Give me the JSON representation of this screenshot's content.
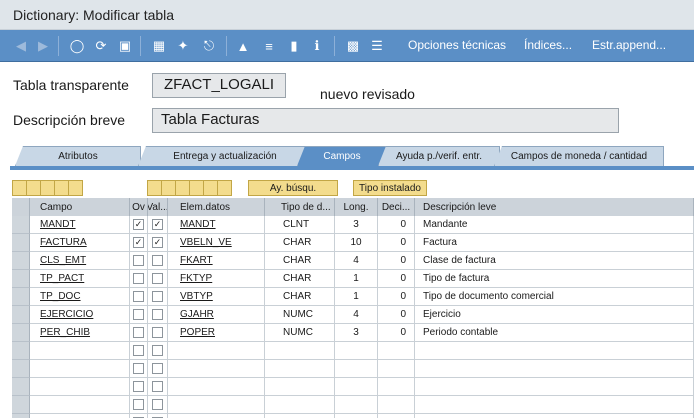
{
  "window": {
    "title": "Dictionary: Modificar tabla"
  },
  "toolbar": {
    "icons": [
      "back-arrow-icon",
      "forward-arrow-icon",
      "glasses-icon",
      "refresh-icon",
      "lock-icon",
      "object-icon",
      "wand-icon",
      "hierarchy-icon",
      "tree-icon",
      "align-icon",
      "blank-icon",
      "info-icon",
      "color-blocks-icon",
      "barcode-icon"
    ],
    "technical_options": "Opciones técnicas",
    "indexes": "Índices...",
    "append_structure": "Estr.append..."
  },
  "form": {
    "table_label": "Tabla transparente",
    "table_value": "ZFACT_LOGALI",
    "status": "nuevo revisado",
    "desc_label": "Descripción breve",
    "desc_value": "Tabla Facturas"
  },
  "tabs": [
    {
      "label": "Atributos",
      "active": false
    },
    {
      "label": "Entrega y actualización",
      "active": false
    },
    {
      "label": "Campos",
      "active": true
    },
    {
      "label": "Ayuda p./verif. entr.",
      "active": false
    },
    {
      "label": "Campos de moneda / cantidad",
      "active": false
    }
  ],
  "buttons": {
    "search_help": "Ay. búsqu.",
    "built_in_type": "Tipo instalado"
  },
  "table": {
    "headers": {
      "campo": "Campo",
      "ov": "Ov",
      "val": "Val...",
      "elem": "Elem.datos",
      "tipo": "Tipo de d...",
      "long": "Long.",
      "deci": "Deci...",
      "desc": "Descripción leve"
    },
    "rows": [
      {
        "campo": "MANDT",
        "ov": true,
        "val": true,
        "elem": "MANDT",
        "tipo": "CLNT",
        "long": "3",
        "deci": "0",
        "desc": "Mandante"
      },
      {
        "campo": "FACTURA",
        "ov": true,
        "val": true,
        "elem": "VBELN_VE",
        "tipo": "CHAR",
        "long": "10",
        "deci": "0",
        "desc": "Factura"
      },
      {
        "campo": "CLS_EMT",
        "ov": false,
        "val": false,
        "elem": "FKART",
        "tipo": "CHAR",
        "long": "4",
        "deci": "0",
        "desc": "Clase de factura"
      },
      {
        "campo": "TP_PACT",
        "ov": false,
        "val": false,
        "elem": "FKTYP",
        "tipo": "CHAR",
        "long": "1",
        "deci": "0",
        "desc": "Tipo de factura"
      },
      {
        "campo": "TP_DOC",
        "ov": false,
        "val": false,
        "elem": "VBTYP",
        "tipo": "CHAR",
        "long": "1",
        "deci": "0",
        "desc": "Tipo de documento comercial"
      },
      {
        "campo": "EJERCICIO",
        "ov": false,
        "val": false,
        "elem": "GJAHR",
        "tipo": "NUMC",
        "long": "4",
        "deci": "0",
        "desc": "Ejercicio"
      },
      {
        "campo": "PER_CHIB",
        "ov": false,
        "val": false,
        "elem": "POPER",
        "tipo": "NUMC",
        "long": "3",
        "deci": "0",
        "desc": "Periodo contable"
      }
    ],
    "empty_rows": 5
  },
  "colors": {
    "toolbar": "#5b8fc6",
    "tab_active": "#5b8fc6",
    "tab_inactive": "#c8d7e6",
    "button_yellow": "#f3dc8d",
    "header_grey": "#ccd3da"
  }
}
